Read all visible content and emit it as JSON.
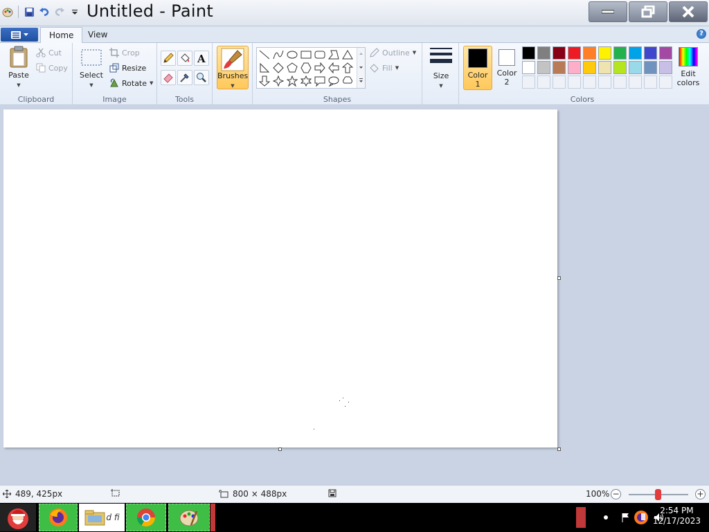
{
  "window": {
    "title": "Untitled - Paint"
  },
  "tabs": {
    "home": "Home",
    "view": "View"
  },
  "clipboard": {
    "paste": "Paste",
    "cut": "Cut",
    "copy": "Copy",
    "group": "Clipboard"
  },
  "image": {
    "select": "Select",
    "crop": "Crop",
    "resize": "Resize",
    "rotate": "Rotate",
    "group": "Image"
  },
  "tools": {
    "group": "Tools"
  },
  "brushes": {
    "label": "Brushes"
  },
  "shapes": {
    "outline": "Outline",
    "fill": "Fill",
    "group": "Shapes"
  },
  "size": {
    "label": "Size"
  },
  "colors": {
    "color1_line1": "Color",
    "color1_line2": "1",
    "color2_line1": "Color",
    "color2_line2": "2",
    "edit_line1": "Edit",
    "edit_line2": "colors",
    "group": "Colors",
    "color1_value": "#000000",
    "color2_value": "#ffffff",
    "palette_row1": [
      "#000000",
      "#7f7f7f",
      "#880015",
      "#ed1c24",
      "#ff7f27",
      "#fff200",
      "#22b14c",
      "#00a2e8",
      "#3f48cc",
      "#a349a4"
    ],
    "palette_row2": [
      "#ffffff",
      "#c3c3c3",
      "#b97a57",
      "#ffaec9",
      "#ffc90e",
      "#efe4b0",
      "#b5e61d",
      "#99d9ea",
      "#7092be",
      "#c8bfe7"
    ]
  },
  "status": {
    "cursor_pos": "489, 425px",
    "canvas_size": "800 × 488px",
    "zoom": "100%"
  },
  "taskbar": {
    "time": "2:54 PM",
    "date": "12/17/2023",
    "explorer_partial": "d fi"
  }
}
